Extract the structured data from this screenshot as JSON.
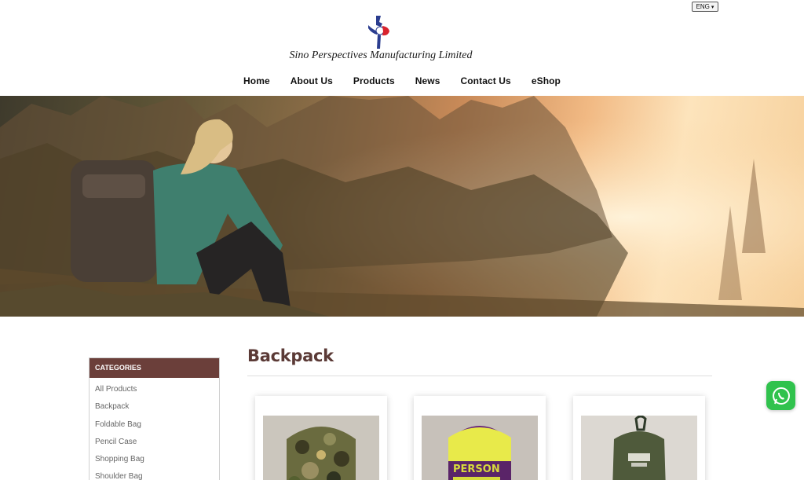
{
  "header": {
    "language": "ENG",
    "company_name": "Sino Perspectives Manufacturing Limited"
  },
  "nav": {
    "items": [
      "Home",
      "About Us",
      "Products",
      "News",
      "Contact Us",
      "eShop"
    ]
  },
  "sidebar": {
    "heading": "CATEGORIES",
    "items": [
      "All Products",
      "Backpack",
      "Foldable Bag",
      "Pencil Case",
      "Shopping Bag",
      "Shoulder Bag"
    ]
  },
  "main": {
    "title": "Backpack",
    "products": [
      {
        "image": "camouflage backpack"
      },
      {
        "image": "yellow and purple backpack",
        "print": "PERSON"
      },
      {
        "image": "olive green backpack"
      }
    ]
  },
  "colors": {
    "category_header": "#6b3f3a",
    "title": "#5b3a36",
    "whatsapp": "#30c24d"
  },
  "icons": [
    "chevron-down-icon",
    "whatsapp-icon"
  ]
}
